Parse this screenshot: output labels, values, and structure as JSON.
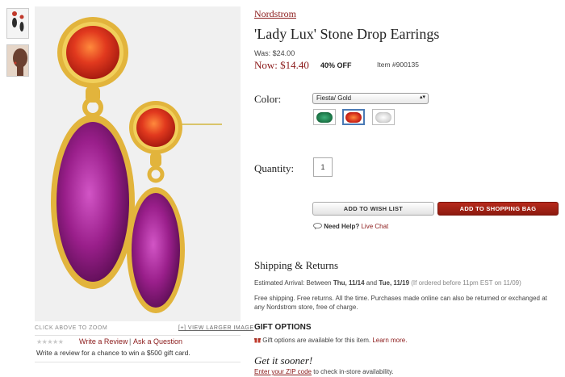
{
  "brand": "Nordstrom",
  "product_title": "'Lady Lux' Stone Drop Earrings",
  "price": {
    "was": "Was: $24.00",
    "now": "Now: $14.40",
    "discount": "40% OFF",
    "item_number": "Item #900135"
  },
  "image_panel": {
    "click_to_zoom": "CLICK ABOVE TO ZOOM",
    "view_larger": "[+] VIEW LARGER IMAGE",
    "rating_stars": "★★★★★",
    "write_review": "Write a Review",
    "separator": "|",
    "ask_question": "Ask a Question",
    "review_promo": "Write a review for a chance to win a $500 gift card."
  },
  "color": {
    "label": "Color:",
    "selected": "Fiesta/ Gold",
    "swatches": [
      {
        "name": "green",
        "color": "#1e7a4a"
      },
      {
        "name": "red",
        "color": "#d0281a"
      },
      {
        "name": "clear",
        "color": "#d8d8d8"
      }
    ],
    "selected_index": 1
  },
  "quantity": {
    "label": "Quantity:",
    "value": "1"
  },
  "buttons": {
    "wish_list": "ADD TO WISH LIST",
    "shopping_bag": "ADD TO SHOPPING BAG"
  },
  "help": {
    "need_help": "Need Help?",
    "live_chat": "Live Chat"
  },
  "shipping": {
    "heading": "Shipping & Returns",
    "arrival_prefix": "Estimated Arrival: Between",
    "date1": "Thu, 11/14",
    "and": "and",
    "date2": "Tue, 11/19",
    "arrival_note": "(If ordered before 11pm EST on 11/09)",
    "policy": "Free shipping. Free returns. All the time. Purchases made online can also be returned or exchanged at any Nordstrom store, free of charge."
  },
  "gift": {
    "heading": "GIFT OPTIONS",
    "text": "Gift options are available for this item.",
    "learn_more": "Learn more."
  },
  "sooner": {
    "heading": "Get it sooner!",
    "zip_link": "Enter your ZIP code",
    "zip_text": "to check in-store availability."
  },
  "colors": {
    "accent": "#8b1a1a",
    "bag_button": "#a3231a"
  }
}
